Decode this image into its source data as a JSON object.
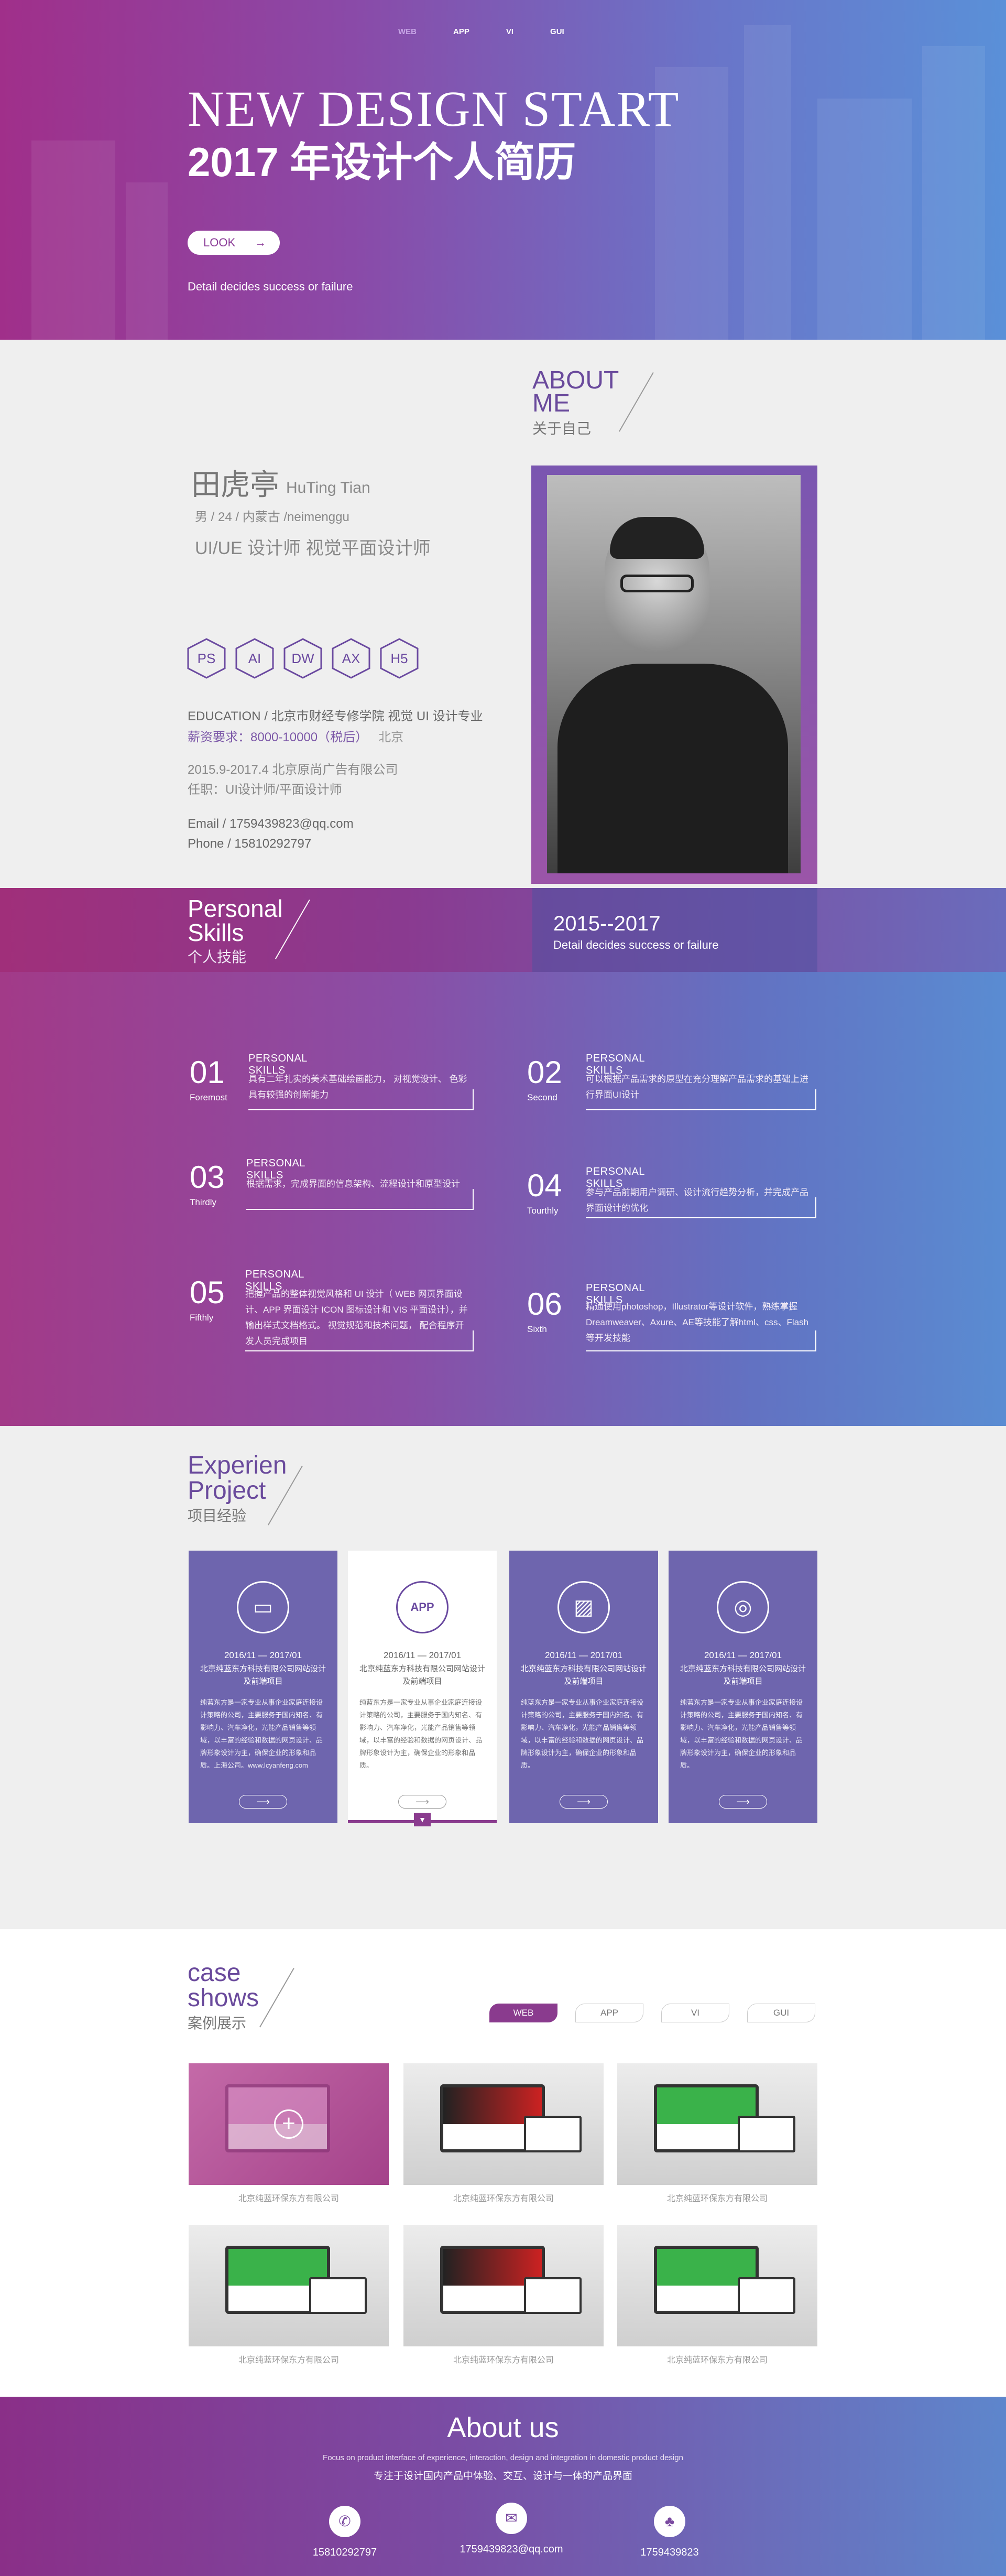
{
  "nav": {
    "items": [
      "WEB",
      "APP",
      "VI",
      "GUI"
    ]
  },
  "hero": {
    "title_en": "NEW DESIGN START",
    "title_cn": "2017 年设计个人简历",
    "button": "LOOK",
    "tagline": "Detail decides success or failure"
  },
  "about": {
    "title_en_1": "ABOUT",
    "title_en_2": "ME",
    "title_cn": "关于自己",
    "name_cn": "田虎亭",
    "name_en": "HuTing  Tian",
    "meta": "男 / 24 / 内蒙古 /neimenggu",
    "roles": "UI/UE 设计师   视觉平面设计师",
    "skills_hex": [
      "PS",
      "AI",
      "DW",
      "AX",
      "H5"
    ],
    "education": "EDUCATION / 北京市财经专修学院 视觉 UI 设计专业",
    "salary": "薪资要求：8000-10000（税后）",
    "location": "北京",
    "work_period": "2015.9-2017.4     北京原尚广告有限公司",
    "work_role": "任职：UI设计师/平面设计师",
    "email": "Email / 1759439823@qq.com",
    "phone": "Phone / 15810292797"
  },
  "skills_band": {
    "title_en_1": "Personal",
    "title_en_2": "Skills",
    "title_cn": "个人技能",
    "year": "2015--2017",
    "year_sub": "Detail decides success or failure"
  },
  "skills": [
    {
      "num": "01",
      "ord": "Foremost",
      "title": "PERSONAL SKILLS",
      "desc": "具有二年扎实的美术基础绘画能力， 对视觉设计、 色彩具有较强的创新能力"
    },
    {
      "num": "02",
      "ord": "Second",
      "title": "PERSONAL SKILLS",
      "desc": "可以根据产品需求的原型在充分理解产品需求的基础上进行界面UI设计"
    },
    {
      "num": "03",
      "ord": "Thirdly",
      "title": "PERSONAL SKILLS",
      "desc": "根据需求，完成界面的信息架构、流程设计和原型设计"
    },
    {
      "num": "04",
      "ord": "Tourthly",
      "title": "PERSONAL SKILLS",
      "desc": "参与产品前期用户调研、设计流行趋势分析，并完成产品界面设计的优化"
    },
    {
      "num": "05",
      "ord": "Fifthly",
      "title": "PERSONAL SKILLS",
      "desc": "把握产品的整体视觉风格和 UI 设计（ WEB 网页界面设计、APP 界面设计 ICON 图标设计和 VIS 平面设计），并输出样式文档格式。 视觉规范和技术问题， 配合程序开发人员完成项目"
    },
    {
      "num": "06",
      "ord": "Sixth",
      "title": "PERSONAL SKILLS",
      "desc": "精通使用photoshop，Illustrator等设计软件，熟练掌握Dreamweaver、Axure、AE等技能了解html、css、Flash等开发技能"
    }
  ],
  "experience": {
    "title_en_1": "Experien",
    "title_en_2": "Project",
    "title_cn": "项目经验",
    "cards": [
      {
        "icon": "monitor-icon",
        "glyph": "▭",
        "date": "2016/11 — 2017/01",
        "company": "北京纯蓝东方科技有限公司网站设计及前端项目",
        "text": "纯蓝东方是一家专业从事企业家庭连接设计策略的公司，主要服务于国内知名、有影响力、汽车净化，光能产品销售等领域，以丰富的经验和数据的网页设计、品牌形象设计为主，确保企业的形象和品质。上海公司。www.lcyanfeng.com",
        "link": "www.lcyanfeng.com"
      },
      {
        "icon": "app-icon",
        "glyph": "APP",
        "date": "2016/11 — 2017/01",
        "company": "北京纯蓝东方科技有限公司网站设计及前端项目",
        "text": "纯蓝东方是一家专业从事企业家庭连接设计策略的公司，主要服务于国内知名、有影响力、汽车净化，光能产品销售等领域，以丰富的经验和数据的网页设计、品牌形象设计为主，确保企业的形象和品质。",
        "link": ""
      },
      {
        "icon": "picture-icon",
        "glyph": "▨",
        "date": "2016/11 — 2017/01",
        "company": "北京纯蓝东方科技有限公司网站设计及前端项目",
        "text": "纯蓝东方是一家专业从事企业家庭连接设计策略的公司，主要服务于国内知名、有影响力、汽车净化，光能产品销售等领域，以丰富的经验和数据的网页设计、品牌形象设计为主，确保企业的形象和品质。",
        "link": ""
      },
      {
        "icon": "instagram-icon",
        "glyph": "◎",
        "date": "2016/11 — 2017/01",
        "company": "北京纯蓝东方科技有限公司网站设计及前端项目",
        "text": "纯蓝东方是一家专业从事企业家庭连接设计策略的公司，主要服务于国内知名、有影响力、汽车净化，光能产品销售等领域，以丰富的经验和数据的网页设计、品牌形象设计为主，确保企业的形象和品质。",
        "link": ""
      }
    ]
  },
  "cases": {
    "title_en_1": "case",
    "title_en_2": "shows",
    "title_cn": "案例展示",
    "tabs": [
      "WEB",
      "APP",
      "VI",
      "GUI"
    ],
    "caption": "北京纯蓝环保东方有限公司"
  },
  "footer": {
    "title": "About us",
    "line_en": "Focus on product interface of experience, interaction, design and integration in domestic product design",
    "line_cn": "专注于设计国内产品中体验、交互、设计与一体的产品界面",
    "contacts": [
      {
        "icon": "phone-icon",
        "glyph": "✆",
        "value": "15810292797"
      },
      {
        "icon": "mail-icon",
        "glyph": "✉",
        "value": "1759439823@qq.com"
      },
      {
        "icon": "qq-icon",
        "glyph": "♣",
        "value": "1759439823"
      }
    ]
  },
  "colors": {
    "accent": "#8a3b8e",
    "purple": "#6e65ae",
    "blue": "#5a8cd2"
  }
}
